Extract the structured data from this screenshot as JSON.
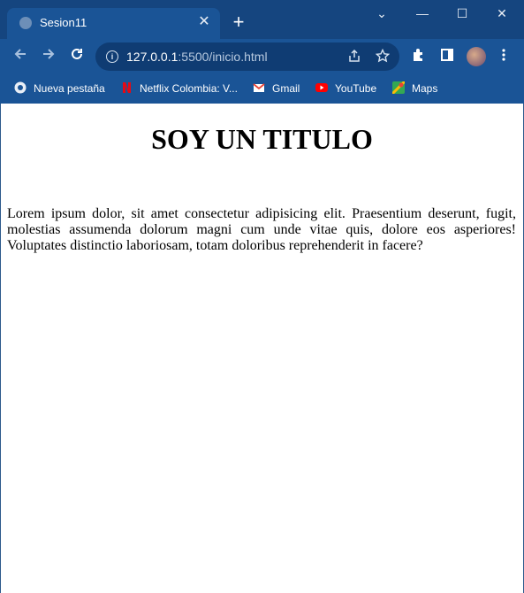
{
  "window": {
    "tab_title": "Sesion11",
    "tab_close": "✕",
    "new_tab": "+",
    "controls": {
      "tabs_menu": "⌄",
      "minimize": "—",
      "maximize": "☐",
      "close": "✕"
    }
  },
  "toolbar": {
    "url_host": "127.0.0.1",
    "url_rest": ":5500/inicio.html",
    "info_glyph": "i"
  },
  "icons": {
    "back": "back-arrow-icon",
    "forward": "forward-arrow-icon",
    "reload": "reload-icon",
    "share": "share-icon",
    "star": "bookmark-star-icon",
    "extensions": "puzzle-icon",
    "sidepanel": "side-panel-icon",
    "menu": "kebab-menu-icon"
  },
  "bookmarks": [
    {
      "label": "Nueva pestaña"
    },
    {
      "label": "Netflix Colombia: V..."
    },
    {
      "label": "Gmail"
    },
    {
      "label": "YouTube"
    },
    {
      "label": "Maps"
    }
  ],
  "page": {
    "heading": "SOY UN TITULO",
    "paragraph": "Lorem ipsum dolor, sit amet consectetur adipisicing elit. Praesentium deserunt, fugit, molestias assumenda dolorum magni cum unde vitae quis, dolore eos asperiores! Voluptates distinctio laboriosam, totam doloribus reprehenderit in facere?"
  },
  "colors": {
    "chrome": "#1a4f8f",
    "titlebar": "#15457f",
    "omnibox": "#0f3c73",
    "netflix_red": "#e50914",
    "youtube_red": "#ff0000"
  }
}
